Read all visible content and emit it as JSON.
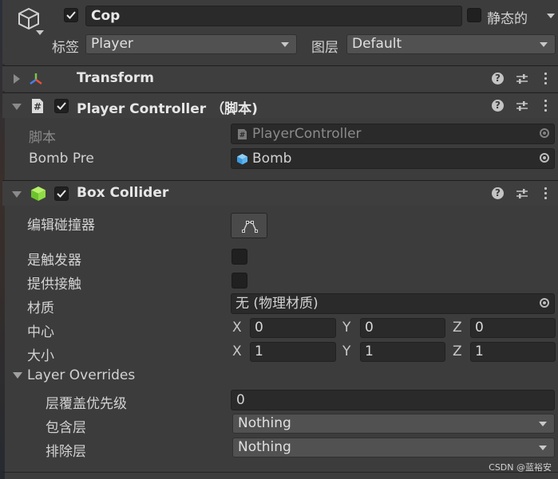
{
  "header": {
    "object_name": "Cop",
    "static_label": "静态的",
    "tag_label": "标签",
    "tag_value": "Player",
    "layer_label": "图层",
    "layer_value": "Default"
  },
  "components": [
    {
      "name": "Transform"
    },
    {
      "name": "Player Controller （脚本)"
    },
    {
      "name": "Box Collider"
    }
  ],
  "player_controller": {
    "script_label": "脚本",
    "script_value": "PlayerController",
    "bomb_label": "Bomb Pre",
    "bomb_value": "Bomb"
  },
  "box_collider": {
    "edit_label": "编辑碰撞器",
    "is_trigger_label": "是触发器",
    "provides_contacts_label": "提供接触",
    "material_label": "材质",
    "material_value": "无 (物理材质)",
    "center_label": "中心",
    "size_label": "大小",
    "axes": [
      "X",
      "Y",
      "Z"
    ],
    "center": [
      "0",
      "0",
      "0"
    ],
    "size": [
      "1",
      "1",
      "1"
    ],
    "layer_overrides_label": "Layer Overrides",
    "priority_label": "层覆盖优先级",
    "priority_value": "0",
    "include_label": "包含层",
    "include_value": "Nothing",
    "exclude_label": "排除层",
    "exclude_value": "Nothing"
  },
  "watermark": "CSDN @蓝裕安",
  "icons": {
    "gameobject": "cube-icon",
    "transform": "transform-axes-icon",
    "script": "hash-script-icon",
    "collider": "green-cube-icon",
    "help": "question-icon",
    "preset": "sliders-icon",
    "more": "kebab-icon"
  }
}
